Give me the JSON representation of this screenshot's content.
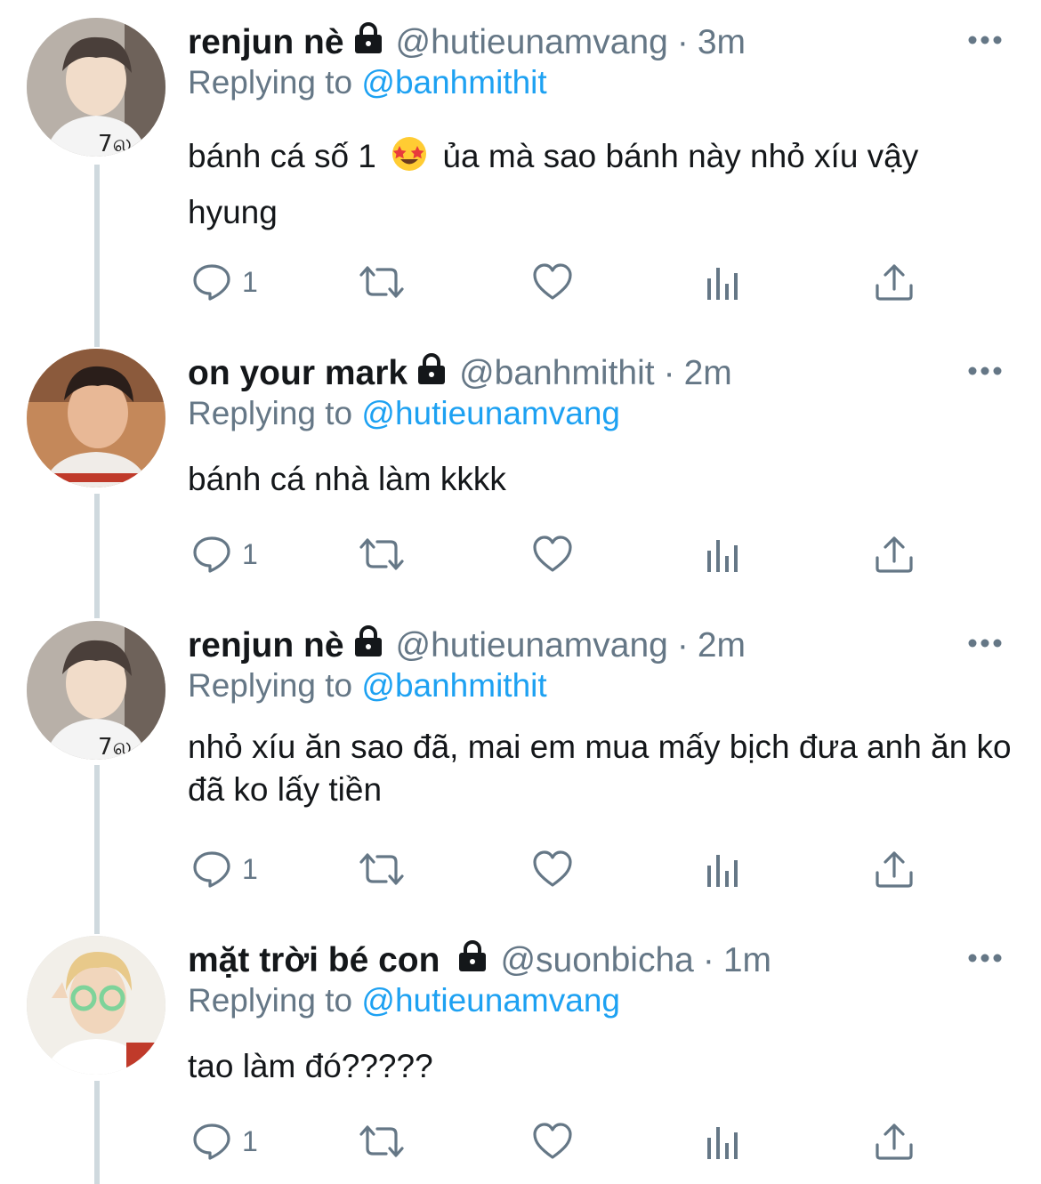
{
  "tweets": [
    {
      "display_name": "renjun nè",
      "handle": "@hutieunamvang",
      "time": "3m",
      "replying_prefix": "Replying to",
      "replying_to": "@banhmithit",
      "text_part1": "bánh cá số 1",
      "emoji": "star-struck-emoji",
      "text_part2": "ủa mà sao bánh này nhỏ xíu vậy hyung",
      "reply_count": "1",
      "avatar": "avatar-renjun"
    },
    {
      "display_name": "on your mark",
      "handle": "@banhmithit",
      "time": "2m",
      "replying_prefix": "Replying to",
      "replying_to": "@hutieunamvang",
      "text": "bánh cá nhà làm kkkk",
      "reply_count": "1",
      "avatar": "avatar-mark"
    },
    {
      "display_name": "renjun nè",
      "handle": "@hutieunamvang",
      "time": "2m",
      "replying_prefix": "Replying to",
      "replying_to": "@banhmithit",
      "text": "nhỏ xíu ăn sao đã, mai em mua mấy bịch đưa anh ăn ko đã ko lấy tiền",
      "reply_count": "1",
      "avatar": "avatar-renjun"
    },
    {
      "display_name": "mặt trời bé con",
      "handle": "@suonbicha",
      "time": "1m",
      "replying_prefix": "Replying to",
      "replying_to": "@hutieunamvang",
      "text": "tao làm đó?????",
      "reply_count": "1",
      "avatar": "avatar-haechan"
    }
  ],
  "colors": {
    "text": "#14171a",
    "secondary": "#657786",
    "link": "#1da1f2",
    "thread_line": "#cfd9de"
  },
  "icons": [
    "lock-icon",
    "more-icon",
    "reply-icon",
    "retweet-icon",
    "like-icon",
    "analytics-icon",
    "share-icon"
  ]
}
